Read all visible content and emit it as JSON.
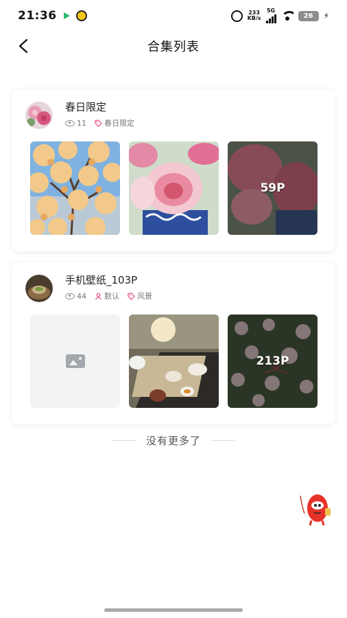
{
  "status_bar": {
    "time": "21:36",
    "net_speed_value": "233",
    "net_speed_unit": "KB/s",
    "network": "5G",
    "battery": "26"
  },
  "nav": {
    "title": "合集列表",
    "back_icon": "chevron-left-icon"
  },
  "collections": [
    {
      "title": "春日限定",
      "views": "11",
      "tag": "春日限定",
      "photo_count": "59P"
    },
    {
      "title": "手机壁纸_103P",
      "views": "44",
      "author": "默认",
      "tag": "风景",
      "photo_count": "213P"
    }
  ],
  "footer": {
    "no_more": "没有更多了"
  },
  "colors": {
    "tag_accent": "#e8487a",
    "background": "#ffffff",
    "placeholder": "#f2f3f5"
  }
}
